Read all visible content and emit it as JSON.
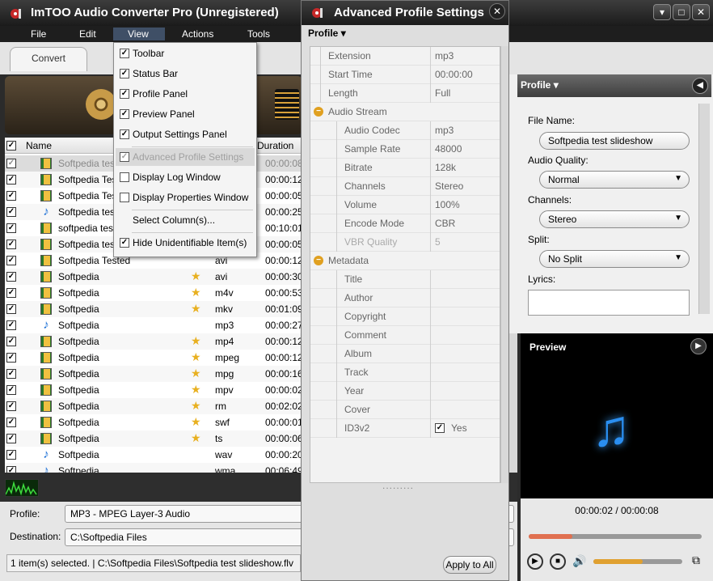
{
  "window": {
    "title": "ImTOO Audio Converter Pro (Unregistered)",
    "minimize": "▾",
    "maximize": "□",
    "close": "✕"
  },
  "menubar": {
    "items": [
      "File",
      "Edit",
      "View",
      "Actions",
      "Tools"
    ]
  },
  "tabs": {
    "convert": "Convert"
  },
  "file_list": {
    "columns": {
      "name": "Name",
      "duration": "Duration"
    },
    "rows": [
      {
        "name": "Softpedia test",
        "icon": "video",
        "star": false,
        "type": "",
        "duration": "00:00:08",
        "checked": true,
        "selected": true
      },
      {
        "name": "Softpedia Tes",
        "icon": "video",
        "star": false,
        "type": "",
        "duration": "00:00:12",
        "checked": true
      },
      {
        "name": "Softpedia Tes",
        "icon": "video",
        "star": false,
        "type": "",
        "duration": "00:00:05",
        "checked": true
      },
      {
        "name": "Softpedia tes",
        "icon": "audio",
        "star": false,
        "type": "",
        "duration": "00:00:25",
        "checked": true
      },
      {
        "name": "softpedia tes",
        "icon": "video",
        "star": false,
        "type": "",
        "duration": "00:10:01",
        "checked": true
      },
      {
        "name": "Softpedia tes",
        "icon": "video",
        "star": false,
        "type": "",
        "duration": "00:00:05",
        "checked": true
      },
      {
        "name": "Softpedia Tested",
        "icon": "video",
        "star": false,
        "type": "avi",
        "duration": "00:00:12",
        "checked": true
      },
      {
        "name": "Softpedia",
        "icon": "video",
        "star": true,
        "type": "avi",
        "duration": "00:00:30",
        "checked": true
      },
      {
        "name": "Softpedia",
        "icon": "video",
        "star": true,
        "type": "m4v",
        "duration": "00:00:53",
        "checked": true
      },
      {
        "name": "Softpedia",
        "icon": "video",
        "star": true,
        "type": "mkv",
        "duration": "00:01:09",
        "checked": true
      },
      {
        "name": "Softpedia",
        "icon": "audio",
        "star": false,
        "type": "mp3",
        "duration": "00:00:27",
        "checked": true
      },
      {
        "name": "Softpedia",
        "icon": "video",
        "star": true,
        "type": "mp4",
        "duration": "00:00:12",
        "checked": true
      },
      {
        "name": "Softpedia",
        "icon": "video",
        "star": true,
        "type": "mpeg",
        "duration": "00:00:12",
        "checked": true
      },
      {
        "name": "Softpedia",
        "icon": "video",
        "star": true,
        "type": "mpg",
        "duration": "00:00:16",
        "checked": true
      },
      {
        "name": "Softpedia",
        "icon": "video",
        "star": true,
        "type": "mpv",
        "duration": "00:00:02",
        "checked": true
      },
      {
        "name": "Softpedia",
        "icon": "video",
        "star": true,
        "type": "rm",
        "duration": "00:02:02",
        "checked": true
      },
      {
        "name": "Softpedia",
        "icon": "video",
        "star": true,
        "type": "swf",
        "duration": "00:00:01",
        "checked": true
      },
      {
        "name": "Softpedia",
        "icon": "video",
        "star": true,
        "type": "ts",
        "duration": "00:00:06",
        "checked": true
      },
      {
        "name": "Softpedia",
        "icon": "audio",
        "star": false,
        "type": "wav",
        "duration": "00:00:20",
        "checked": true
      },
      {
        "name": "Softpedia",
        "icon": "audio",
        "star": false,
        "type": "wma",
        "duration": "00:06:49",
        "checked": true
      }
    ]
  },
  "view_menu": {
    "items": [
      {
        "label": "Toolbar",
        "checked": true
      },
      {
        "label": "Status Bar",
        "checked": true
      },
      {
        "label": "Profile Panel",
        "checked": true
      },
      {
        "label": "Preview Panel",
        "checked": true
      },
      {
        "label": "Output Settings Panel",
        "checked": true
      },
      {
        "label": "Advanced Profile Settings",
        "checked": true,
        "highlighted": true
      },
      {
        "label": "Display Log Window",
        "checked": false
      },
      {
        "label": "Display Properties Window",
        "checked": false
      },
      {
        "label": "Select Column(s)...",
        "checked": null
      },
      {
        "label": "Hide Unidentifiable Item(s)",
        "checked": true
      }
    ]
  },
  "bottom": {
    "profile_label": "Profile:",
    "profile_value": "MP3 - MPEG Layer-3 Audio",
    "destination_label": "Destination:",
    "destination_value": "C:\\Softpedia Files",
    "status": "1 item(s) selected. | C:\\Softpedia Files\\Softpedia test slideshow.flv"
  },
  "advanced_profile": {
    "title": "Advanced Profile Settings",
    "profile_menu": "Profile",
    "rows": [
      {
        "key": "Extension",
        "value": "mp3",
        "level": 0
      },
      {
        "key": "Start Time",
        "value": "00:00:00",
        "level": 0
      },
      {
        "key": "Length",
        "value": "Full",
        "level": 0
      },
      {
        "key": "Audio Stream",
        "value": "",
        "level": "group"
      },
      {
        "key": "Audio Codec",
        "value": "mp3",
        "level": 1
      },
      {
        "key": "Sample Rate",
        "value": "48000",
        "level": 1
      },
      {
        "key": "Bitrate",
        "value": "128k",
        "level": 1
      },
      {
        "key": "Channels",
        "value": "Stereo",
        "level": 1
      },
      {
        "key": "Volume",
        "value": "100%",
        "level": 1
      },
      {
        "key": "Encode Mode",
        "value": "CBR",
        "level": 1
      },
      {
        "key": "VBR Quality",
        "value": "5",
        "level": 1,
        "dim": true
      },
      {
        "key": "Metadata",
        "value": "",
        "level": "group"
      },
      {
        "key": "Title",
        "value": "",
        "level": 1
      },
      {
        "key": "Author",
        "value": "",
        "level": 1
      },
      {
        "key": "Copyright",
        "value": "",
        "level": 1
      },
      {
        "key": "Comment",
        "value": "",
        "level": 1
      },
      {
        "key": "Album",
        "value": "",
        "level": 1
      },
      {
        "key": "Track",
        "value": "",
        "level": 1
      },
      {
        "key": "Year",
        "value": "",
        "level": 1
      },
      {
        "key": "Cover",
        "value": "",
        "level": 1
      },
      {
        "key": "ID3v2",
        "value": "Yes",
        "level": 1,
        "checkbox": true
      }
    ],
    "apply_all": "Apply to All"
  },
  "profile_panel": {
    "title": "Profile",
    "file_name_label": "File Name:",
    "file_name_value": "Softpedia test slideshow",
    "audio_quality_label": "Audio Quality:",
    "audio_quality_value": "Normal",
    "channels_label": "Channels:",
    "channels_value": "Stereo",
    "split_label": "Split:",
    "split_value": "No Split",
    "lyrics_label": "Lyrics:"
  },
  "preview": {
    "title": "Preview",
    "time": "00:00:02 / 00:00:08",
    "progress_fraction": 0.25,
    "volume_fraction": 0.55
  }
}
